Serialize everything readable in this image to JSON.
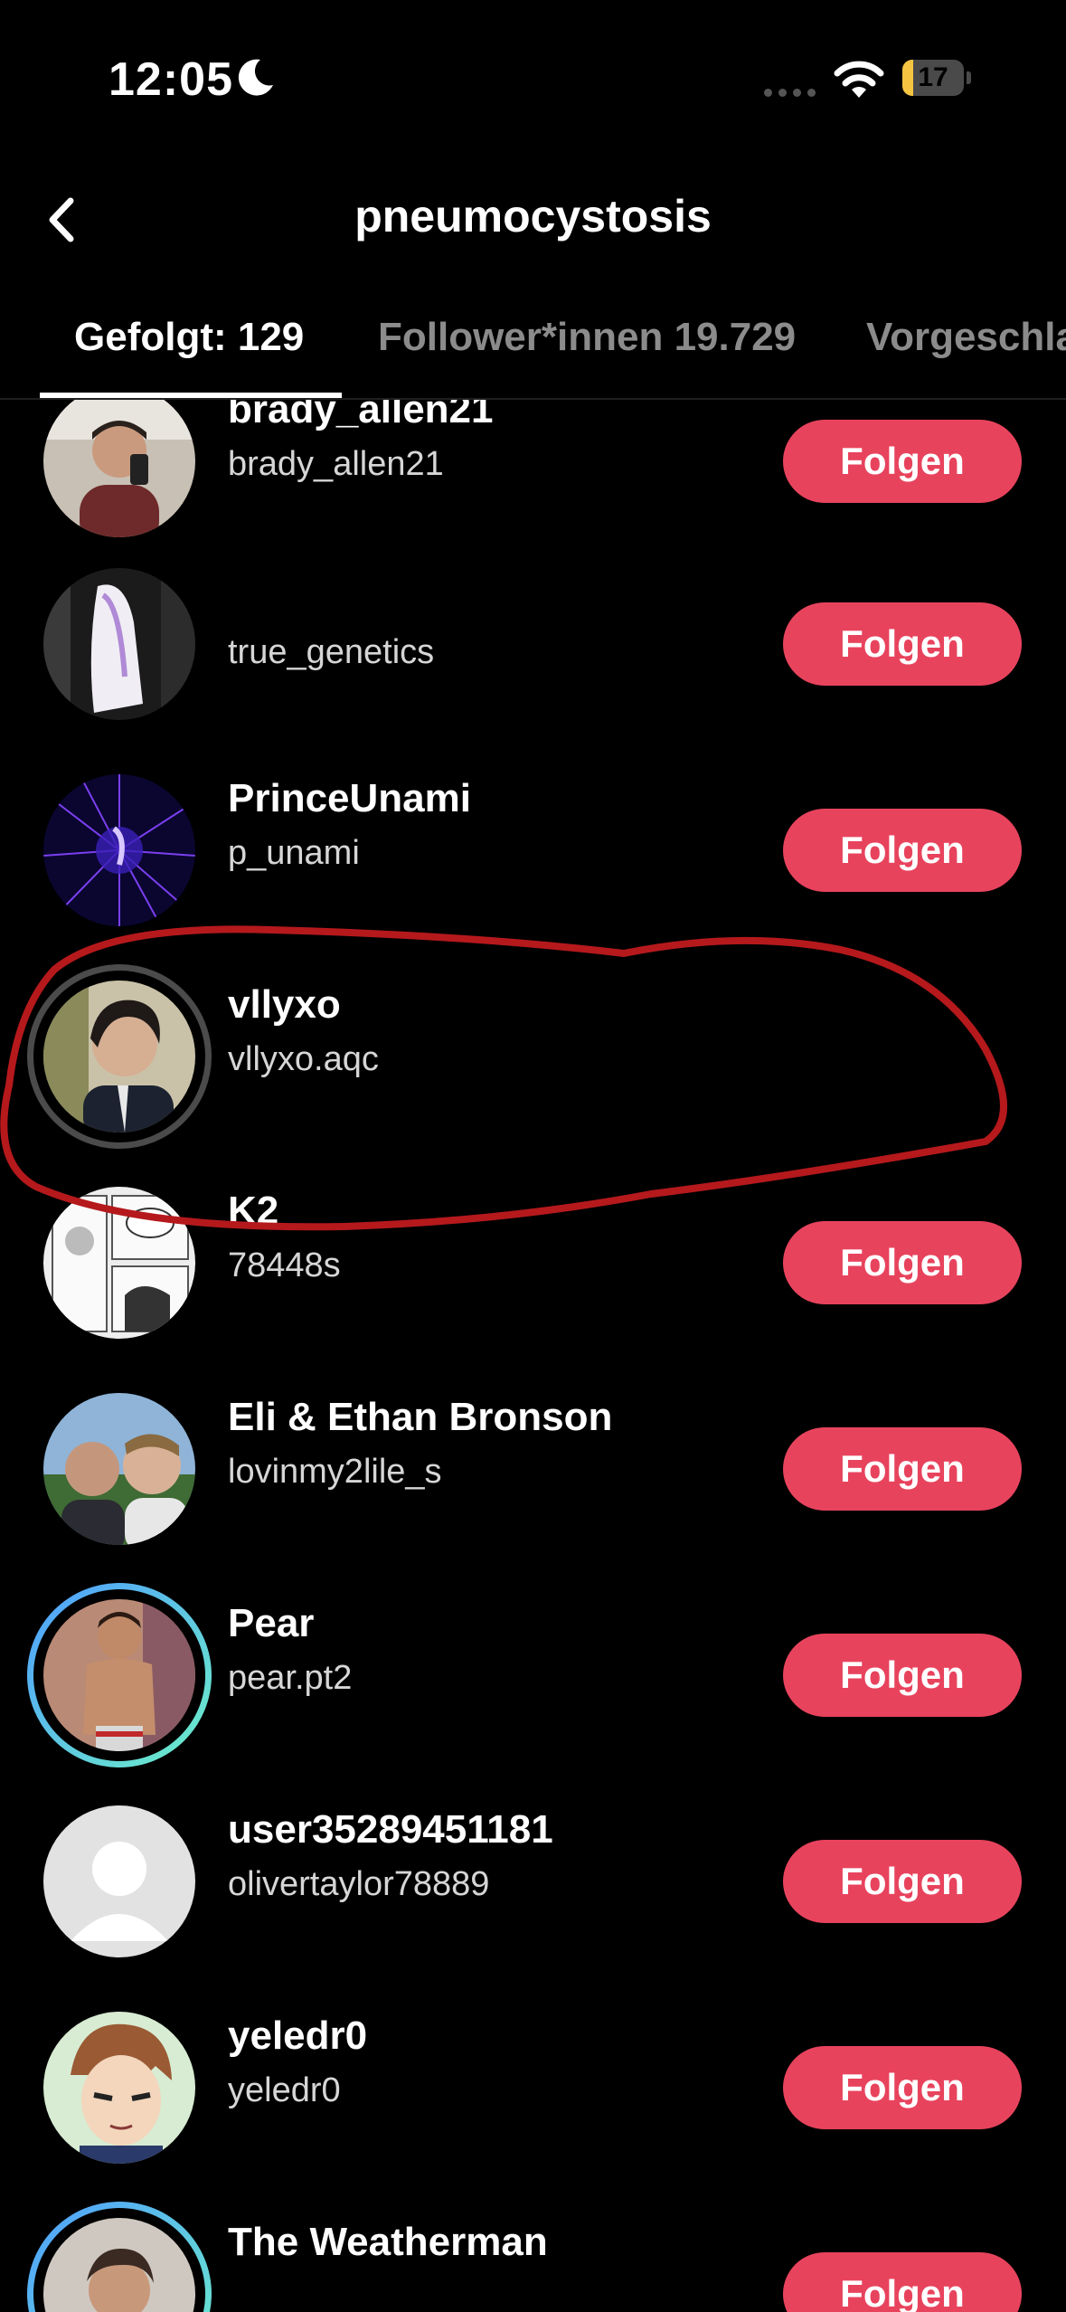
{
  "status_bar": {
    "time": "12:05",
    "battery_level": "17",
    "battery_fraction": 0.17,
    "icons": [
      "moon-icon",
      "signal-dots-icon",
      "wifi-icon",
      "battery-icon"
    ]
  },
  "header": {
    "title": "pneumocystosis",
    "back_icon": "chevron-left-icon"
  },
  "tabs": [
    {
      "label": "Gefolgt: 129",
      "active": true
    },
    {
      "label": "Follower*innen 19.729",
      "active": false
    },
    {
      "label": "Vorgeschla",
      "active": false
    }
  ],
  "colors": {
    "accent": "#e8435d",
    "background": "#000000",
    "annotation": "#b5191c"
  },
  "users": [
    {
      "name": "brady_allen21",
      "handle": "brady_allen21",
      "button": "Folgen"
    },
    {
      "name": "",
      "handle": "true_genetics",
      "button": "Folgen"
    },
    {
      "name": "PrinceUnami",
      "handle": "p_unami",
      "button": "Folgen"
    },
    {
      "name": "vllyxo",
      "handle": "vllyxo.aqc",
      "button": ""
    },
    {
      "name": "K2",
      "handle": "78448s",
      "button": "Folgen"
    },
    {
      "name": "Eli & Ethan Bronson",
      "handle": "lovinmy2lile_s",
      "button": "Folgen"
    },
    {
      "name": "Pear",
      "handle": "pear.pt2",
      "button": "Folgen"
    },
    {
      "name": "user35289451181",
      "handle": "olivertaylor78889",
      "button": "Folgen"
    },
    {
      "name": "yeledr0",
      "handle": "yeledr0",
      "button": "Folgen"
    },
    {
      "name": "The Weatherman",
      "handle": "",
      "button": "Folgen"
    }
  ]
}
